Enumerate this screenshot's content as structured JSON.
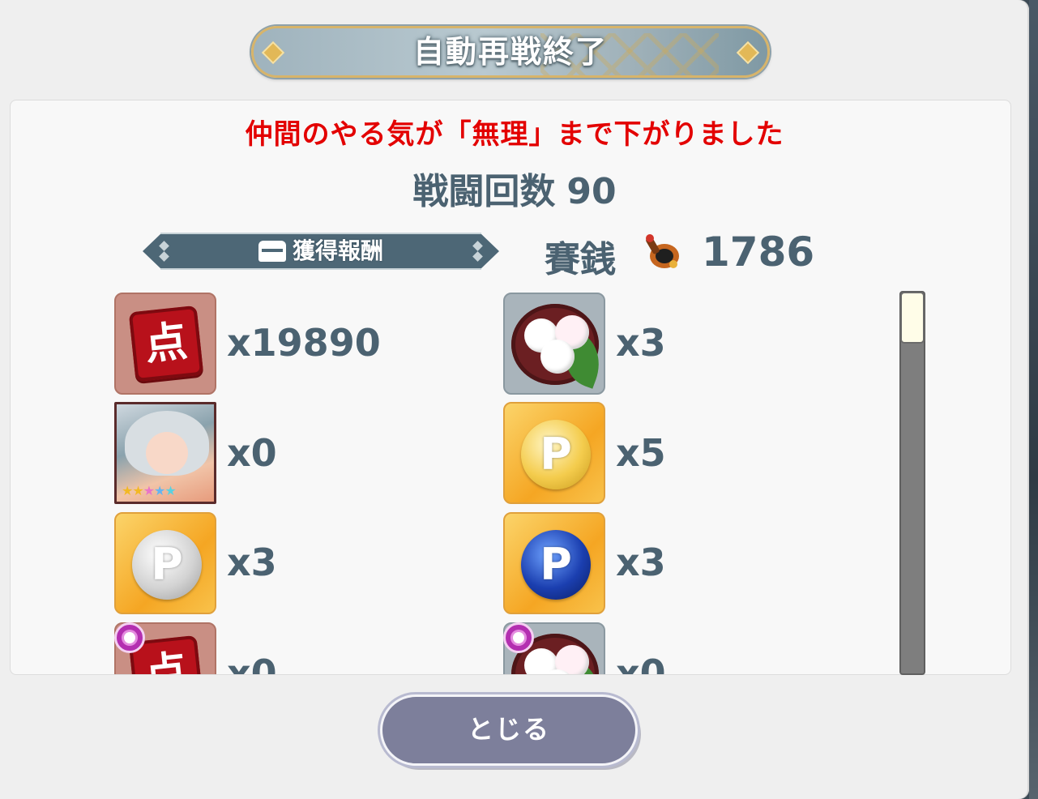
{
  "dialog": {
    "title": "自動再戦終了",
    "warning": "仲間のやる気が「無理」まで下がりました",
    "battle_count_label": "戦闘回数",
    "battle_count_value": "90",
    "rewards_label": "獲得報酬",
    "money_label": "賽銭",
    "money_value": "1786",
    "close_label": "とじる"
  },
  "rewards": [
    {
      "icon": "point-ticket-icon",
      "qty": "x19890"
    },
    {
      "icon": "dango-plate-icon",
      "qty": "x3"
    },
    {
      "icon": "character-portrait-icon",
      "qty": "x0"
    },
    {
      "icon": "gold-p-coin-icon",
      "qty": "x5"
    },
    {
      "icon": "silver-p-coin-icon",
      "qty": "x3"
    },
    {
      "icon": "blue-p-coin-icon",
      "qty": "x3"
    },
    {
      "icon": "point-ticket-bonus-icon",
      "qty": "x0"
    },
    {
      "icon": "dango-plate-bonus-icon",
      "qty": "x0"
    }
  ],
  "point_glyph": "点",
  "coin_glyph": "P",
  "stars": "★★★★★",
  "colors": {
    "warning": "#e30000",
    "text": "#4b6271",
    "ribbon": "#4d6776",
    "button": "#7d7f9b"
  }
}
